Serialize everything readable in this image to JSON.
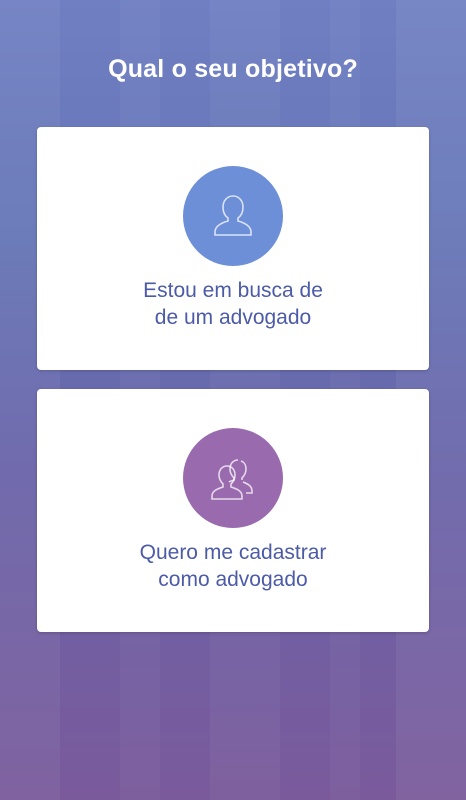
{
  "header": {
    "title": "Qual o seu objetivo?"
  },
  "options": [
    {
      "icon": "user-icon",
      "line1": "Estou em busca de",
      "line2": "de um advogado",
      "color": "#6c8fd8"
    },
    {
      "icon": "users-icon",
      "line1": "Quero me cadastrar",
      "line2": "como advogado",
      "color": "#9a6aae"
    }
  ],
  "theme": {
    "text_color": "#4c5ba8",
    "background_top": "#6f7fc2",
    "background_bottom": "#7a5a9b"
  }
}
